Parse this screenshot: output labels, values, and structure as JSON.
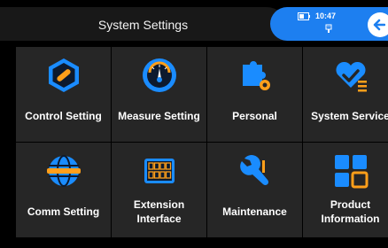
{
  "header": {
    "title": "System Settings",
    "time": "10:47",
    "battery_icon": "battery-icon",
    "usb_icon": "usb-icon",
    "back_icon": "back-arrow-icon"
  },
  "colors": {
    "accent": "#1d7ff0",
    "tile_bg": "#262626",
    "icon_blue": "#1a8cff",
    "icon_orange": "#ff9f1a"
  },
  "tiles": [
    {
      "label": "Control Setting",
      "icon": "control-setting-icon"
    },
    {
      "label": "Measure Setting",
      "icon": "gauge-icon"
    },
    {
      "label": "Personal",
      "icon": "puzzle-icon"
    },
    {
      "label": "System Service",
      "icon": "heart-service-icon"
    },
    {
      "label": "Comm Setting",
      "icon": "globe-icon"
    },
    {
      "label": "Extension Interface",
      "line1": "Extension",
      "line2": "Interface",
      "icon": "interface-board-icon"
    },
    {
      "label": "Maintenance",
      "icon": "wrench-icon"
    },
    {
      "label": "Product Information",
      "line1": "Product",
      "line2": "Information",
      "icon": "product-grid-icon"
    }
  ]
}
